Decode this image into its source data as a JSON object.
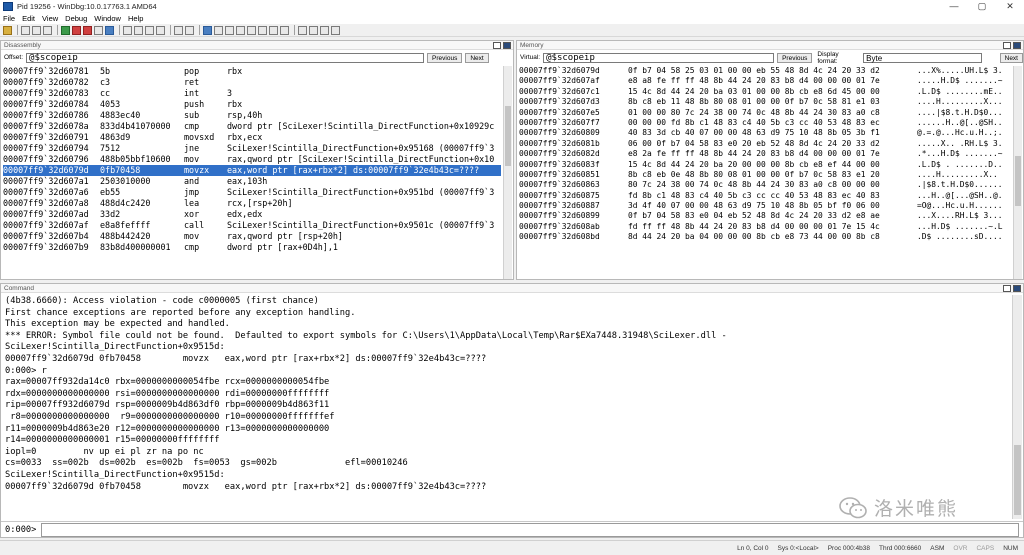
{
  "window": {
    "title": "Pid 19256 - WinDbg:10.0.17763.1 AMD64",
    "controls": [
      "—",
      "▢",
      "✕"
    ]
  },
  "menu": [
    "File",
    "Edit",
    "View",
    "Debug",
    "Window",
    "Help"
  ],
  "disassembly": {
    "title": "Disassembly",
    "offset_label": "Offset:",
    "offset_value": "@$scopeip",
    "previous_label": "Previous",
    "next_label": "Next",
    "lines": [
      {
        "addr": "00007ff9`32d60781",
        "bytes": "5b",
        "mn": "pop",
        "op": "rbx"
      },
      {
        "addr": "00007ff9`32d60782",
        "bytes": "c3",
        "mn": "ret",
        "op": ""
      },
      {
        "addr": "00007ff9`32d60783",
        "bytes": "cc",
        "mn": "int",
        "op": "3"
      },
      {
        "addr": "00007ff9`32d60784",
        "bytes": "4053",
        "mn": "push",
        "op": "rbx"
      },
      {
        "addr": "00007ff9`32d60786",
        "bytes": "4883ec40",
        "mn": "sub",
        "op": "rsp,40h"
      },
      {
        "addr": "00007ff9`32d6078a",
        "bytes": "833d4b41070000",
        "mn": "cmp",
        "op": "dword ptr [SciLexer!Scintilla_DirectFunction+0x10929c"
      },
      {
        "addr": "00007ff9`32d60791",
        "bytes": "4863d9",
        "mn": "movsxd",
        "op": "rbx,ecx"
      },
      {
        "addr": "00007ff9`32d60794",
        "bytes": "7512",
        "mn": "jne",
        "op": "SciLexer!Scintilla_DirectFunction+0x95168 (00007ff9`3"
      },
      {
        "addr": "00007ff9`32d60796",
        "bytes": "488b05bbf10600",
        "mn": "mov",
        "op": "rax,qword ptr [SciLexer!Scintilla_DirectFunction+0x10"
      },
      {
        "addr": "00007ff9`32d6079d",
        "bytes": "0fb70458",
        "mn": "movzx",
        "op": "eax,word ptr [rax+rbx*2] ds:00007ff9`32e4b43c=????",
        "selected": true
      },
      {
        "addr": "00007ff9`32d607a1",
        "bytes": "2503010000",
        "mn": "and",
        "op": "eax,103h"
      },
      {
        "addr": "00007ff9`32d607a6",
        "bytes": "eb55",
        "mn": "jmp",
        "op": "SciLexer!Scintilla_DirectFunction+0x951bd (00007ff9`3"
      },
      {
        "addr": "00007ff9`32d607a8",
        "bytes": "488d4c2420",
        "mn": "lea",
        "op": "rcx,[rsp+20h]"
      },
      {
        "addr": "00007ff9`32d607ad",
        "bytes": "33d2",
        "mn": "xor",
        "op": "edx,edx"
      },
      {
        "addr": "00007ff9`32d607af",
        "bytes": "e8a8feffff",
        "mn": "call",
        "op": "SciLexer!Scintilla_DirectFunction+0x9501c (00007ff9`3"
      },
      {
        "addr": "00007ff9`32d607b4",
        "bytes": "488b442420",
        "mn": "mov",
        "op": "rax,qword ptr [rsp+20h]"
      },
      {
        "addr": "00007ff9`32d607b9",
        "bytes": "83b8d400000001",
        "mn": "cmp",
        "op": "dword ptr [rax+0D4h],1"
      }
    ]
  },
  "memory": {
    "title": "Memory",
    "virtual_label": "Virtual:",
    "virtual_value": "@$scopeip",
    "previous_label": "Previous",
    "display_format_label": "Display format:",
    "display_format_value": "Byte",
    "next_label": "Next",
    "lines": [
      {
        "addr": "00007ff9`32d6079d",
        "hex": "0f b7 04 58 25 03 01 00 00 eb 55 48 8d 4c 24 20 33 d2",
        "ascii": "...X%.....UH.L$ 3."
      },
      {
        "addr": "00007ff9`32d607af",
        "hex": "e8 a8 fe ff ff 48 8b 44 24 20 83 b8 d4 00 00 00 01 7e",
        "ascii": ".....H.D$ .......~"
      },
      {
        "addr": "00007ff9`32d607c1",
        "hex": "15 4c 8d 44 24 20 ba 03 01 00 00 8b cb e8 6d 45 00 00",
        "ascii": ".L.D$ ........mE.."
      },
      {
        "addr": "00007ff9`32d607d3",
        "hex": "8b c8 eb 11 48 8b 80 08 01 00 00 0f b7 0c 58 81 e1 03",
        "ascii": "....H.........X..."
      },
      {
        "addr": "00007ff9`32d607e5",
        "hex": "01 00 00 80 7c 24 38 00 74 0c 48 8b 44 24 30 83 a0 c8",
        "ascii": "....|$8.t.H.D$0..."
      },
      {
        "addr": "00007ff9`32d607f7",
        "hex": "00 00 00 fd 8b c1 48 83 c4 40 5b c3 cc 40 53 48 83 ec",
        "ascii": "......H..@[..@SH.."
      },
      {
        "addr": "00007ff9`32d60809",
        "hex": "40 83 3d cb 40 07 00 00 48 63 d9 75 10 48 8b 05 3b f1",
        "ascii": "@.=.@...Hc.u.H..;."
      },
      {
        "addr": "00007ff9`32d6081b",
        "hex": "06 00 0f b7 04 58 83 e0 20 eb 52 48 8d 4c 24 20 33 d2",
        "ascii": ".....X.. .RH.L$ 3."
      },
      {
        "addr": "00007ff9`32d6082d",
        "hex": "e8 2a fe ff ff 48 8b 44 24 20 83 b8 d4 00 00 00 01 7e",
        "ascii": ".*...H.D$ .......~"
      },
      {
        "addr": "00007ff9`32d6083f",
        "hex": "15 4c 8d 44 24 20 ba 20 00 00 00 8b cb e8 ef 44 00 00",
        "ascii": ".L.D$ . .......D.."
      },
      {
        "addr": "00007ff9`32d60851",
        "hex": "8b c8 eb 0e 48 8b 80 08 01 00 00 0f b7 0c 58 83 e1 20",
        "ascii": "....H.........X.. "
      },
      {
        "addr": "00007ff9`32d60863",
        "hex": "80 7c 24 38 00 74 0c 48 8b 44 24 30 83 a0 c8 00 00 00",
        "ascii": ".|$8.t.H.D$0......"
      },
      {
        "addr": "00007ff9`32d60875",
        "hex": "fd 8b c1 48 83 c4 40 5b c3 cc cc 40 53 48 83 ec 40 83",
        "ascii": "...H..@[...@SH..@."
      },
      {
        "addr": "00007ff9`32d60887",
        "hex": "3d 4f 40 07 00 00 48 63 d9 75 10 48 8b 05 bf f0 06 00",
        "ascii": "=O@...Hc.u.H......"
      },
      {
        "addr": "00007ff9`32d60899",
        "hex": "0f b7 04 58 83 e0 04 eb 52 48 8d 4c 24 20 33 d2 e8 ae",
        "ascii": "...X....RH.L$ 3..."
      },
      {
        "addr": "00007ff9`32d608ab",
        "hex": "fd ff ff 48 8b 44 24 20 83 b8 d4 00 00 00 01 7e 15 4c",
        "ascii": "...H.D$ .......~.L"
      },
      {
        "addr": "00007ff9`32d608bd",
        "hex": "8d 44 24 20 ba 04 00 00 00 8b cb e8 73 44 00 00 8b c8",
        "ascii": ".D$ ........sD...."
      }
    ]
  },
  "command": {
    "title": "Command",
    "prompt": "0:000>",
    "output": [
      "(4b38.6660): Access violation - code c0000005 (first chance)",
      "First chance exceptions are reported before any exception handling.",
      "This exception may be expected and handled.",
      "*** ERROR: Symbol file could not be found.  Defaulted to export symbols for C:\\Users\\1\\AppData\\Local\\Temp\\Rar$EXa7448.31948\\SciLexer.dll -",
      "SciLexer!Scintilla_DirectFunction+0x9515d:",
      "00007ff9`32d6079d 0fb70458        movzx   eax,word ptr [rax+rbx*2] ds:00007ff9`32e4b43c=????",
      "0:000> r",
      "rax=00007ff932da14c0 rbx=0000000000054fbe rcx=0000000000054fbe",
      "rdx=0000000000000000 rsi=0000000000000000 rdi=00000000ffffffff",
      "rip=00007ff932d6079d rsp=0000009b4d863df0 rbp=0000009b4d863f11",
      " r8=0000000000000000  r9=0000000000000000 r10=00000000fffffffef",
      "r11=0000009b4d863e20 r12=0000000000000000 r13=0000000000000000",
      "r14=0000000000000001 r15=00000000ffffffff",
      "iopl=0         nv up ei pl zr na po nc",
      "cs=0033  ss=002b  ds=002b  es=002b  fs=0053  gs=002b             efl=00010246",
      "SciLexer!Scintilla_DirectFunction+0x9515d:",
      "00007ff9`32d6079d 0fb70458        movzx   eax,word ptr [rax+rbx*2] ds:00007ff9`32e4b43c=????"
    ]
  },
  "watermark": {
    "text": "洛米唯熊"
  },
  "status": [
    "Ln 0, Col 0",
    "Sys 0:<Local>",
    "Proc 000:4b38",
    "Thrd 000:6660",
    "ASM",
    "OVR",
    "CAPS",
    "NUM"
  ]
}
